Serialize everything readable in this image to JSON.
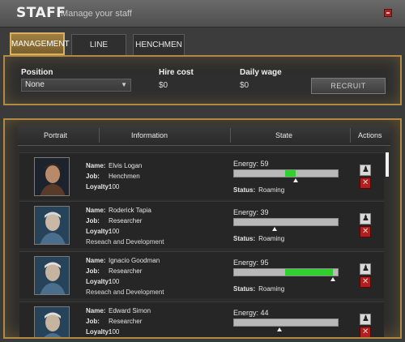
{
  "header": {
    "title": "STAFF",
    "subtitle": "Manage your staff"
  },
  "tabs": [
    {
      "label": "MANAGEMENT",
      "active": true
    },
    {
      "label": "LINE CONTROL",
      "active": false
    },
    {
      "label": "HENCHMEN",
      "active": false
    }
  ],
  "hire": {
    "position_label": "Position",
    "position_value": "None",
    "hire_cost_label": "Hire cost",
    "hire_cost_value": "$0",
    "daily_wage_label": "Daily wage",
    "daily_wage_value": "$0",
    "recruit_label": "RECRUIT"
  },
  "table": {
    "columns": [
      "Portrait",
      "Information",
      "State",
      "Actions"
    ],
    "field_labels": {
      "name": "Name:",
      "job": "Job:",
      "loyalty": "Loyalty:",
      "energy": "Energy:",
      "status": "Status:"
    },
    "rows": [
      {
        "name": "Elvis Logan",
        "job": "Henchmen",
        "loyalty": "100",
        "extra": "",
        "energy": 59,
        "energy_text": "59",
        "status": "Roaming"
      },
      {
        "name": "Roderick Tapia",
        "job": "Researcher",
        "loyalty": "100",
        "extra": "Reseach and Development",
        "energy": 39,
        "energy_text": "39",
        "status": "Roaming"
      },
      {
        "name": "Ignacio Goodman",
        "job": "Researcher",
        "loyalty": "100",
        "extra": "Reseach and Development",
        "energy": 95,
        "energy_text": "95",
        "status": "Roaming"
      },
      {
        "name": "Edward Simon",
        "job": "Researcher",
        "loyalty": "100",
        "extra": "",
        "energy": 44,
        "energy_text": "44",
        "status": ""
      }
    ]
  },
  "colors": {
    "accent": "#b08a44",
    "energy_fill": "#2fd02f",
    "close": "#a8231f"
  },
  "icons": {
    "close": "close-icon",
    "info": "info-icon",
    "fire": "fire-icon"
  }
}
